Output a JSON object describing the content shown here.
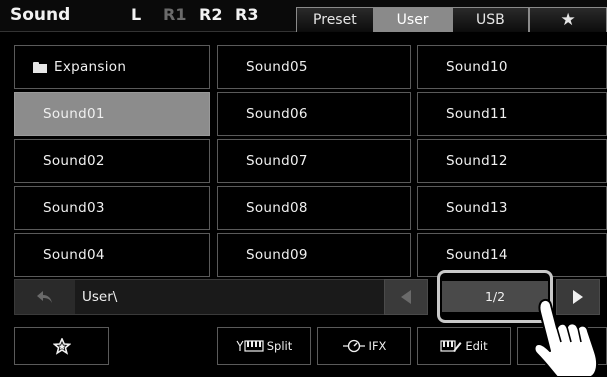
{
  "header": {
    "title": "Sound",
    "parts": [
      {
        "label": "L",
        "active": true
      },
      {
        "label": "R1",
        "active": false
      },
      {
        "label": "R2",
        "active": true
      },
      {
        "label": "R3",
        "active": true
      }
    ],
    "tabs": [
      {
        "label": "Preset",
        "active": false
      },
      {
        "label": "User",
        "active": true
      },
      {
        "label": "USB",
        "active": false
      },
      {
        "label": "★",
        "icon": "star-icon",
        "active": false
      }
    ]
  },
  "grid": {
    "col1": [
      "Expansion",
      "Sound01",
      "Sound02",
      "Sound03",
      "Sound04"
    ],
    "col2": [
      "Sound05",
      "Sound06",
      "Sound07",
      "Sound08",
      "Sound09"
    ],
    "col3": [
      "Sound10",
      "Sound11",
      "Sound12",
      "Sound13",
      "Sound14"
    ],
    "selected": "Sound01"
  },
  "path": {
    "text": "User\\"
  },
  "page": {
    "indicator": "1/2"
  },
  "toolbar": {
    "favorite_icon": "star-outline-icon",
    "split_label": "Split",
    "ifx_label": "IFX",
    "edit_label": "Edit"
  },
  "colors": {
    "background": "#000000",
    "selected": "#8c8c8c",
    "active_tab": "#8a8a8a",
    "border": "#5a5a5a"
  }
}
